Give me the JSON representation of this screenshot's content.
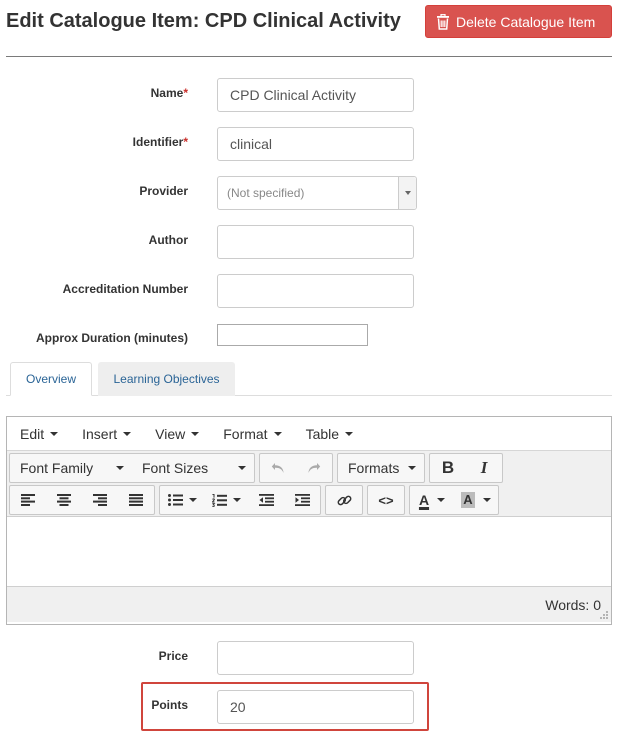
{
  "page": {
    "title": "Edit Catalogue Item: CPD Clinical Activity",
    "delete_label": "Delete Catalogue Item"
  },
  "form": {
    "name_label": "Name",
    "name_value": "CPD Clinical Activity",
    "identifier_label": "Identifier",
    "identifier_value": "clinical",
    "required_mark": "*",
    "provider_label": "Provider",
    "provider_value": "(Not specified)",
    "author_label": "Author",
    "author_value": "",
    "accreditation_label": "Accreditation Number",
    "accreditation_value": "",
    "duration_label": "Approx Duration (minutes)",
    "duration_value": "",
    "price_label": "Price",
    "price_value": "",
    "points_label": "Points",
    "points_value": "20"
  },
  "tabs": [
    {
      "label": "Overview",
      "active": true
    },
    {
      "label": "Learning Objectives",
      "active": false
    }
  ],
  "editor": {
    "menu": [
      "Edit",
      "Insert",
      "View",
      "Format",
      "Table"
    ],
    "font_family_label": "Font Family",
    "font_sizes_label": "Font Sizes",
    "formats_label": "Formats",
    "bold_label": "B",
    "italic_label": "I",
    "code_label": "<>",
    "text_color_label": "A",
    "bg_color_label": "A",
    "word_count": "Words: 0"
  },
  "colors": {
    "danger": "#d9534f",
    "link": "#2a6496",
    "highlight": "#d0453c",
    "required": "#c9302c"
  }
}
